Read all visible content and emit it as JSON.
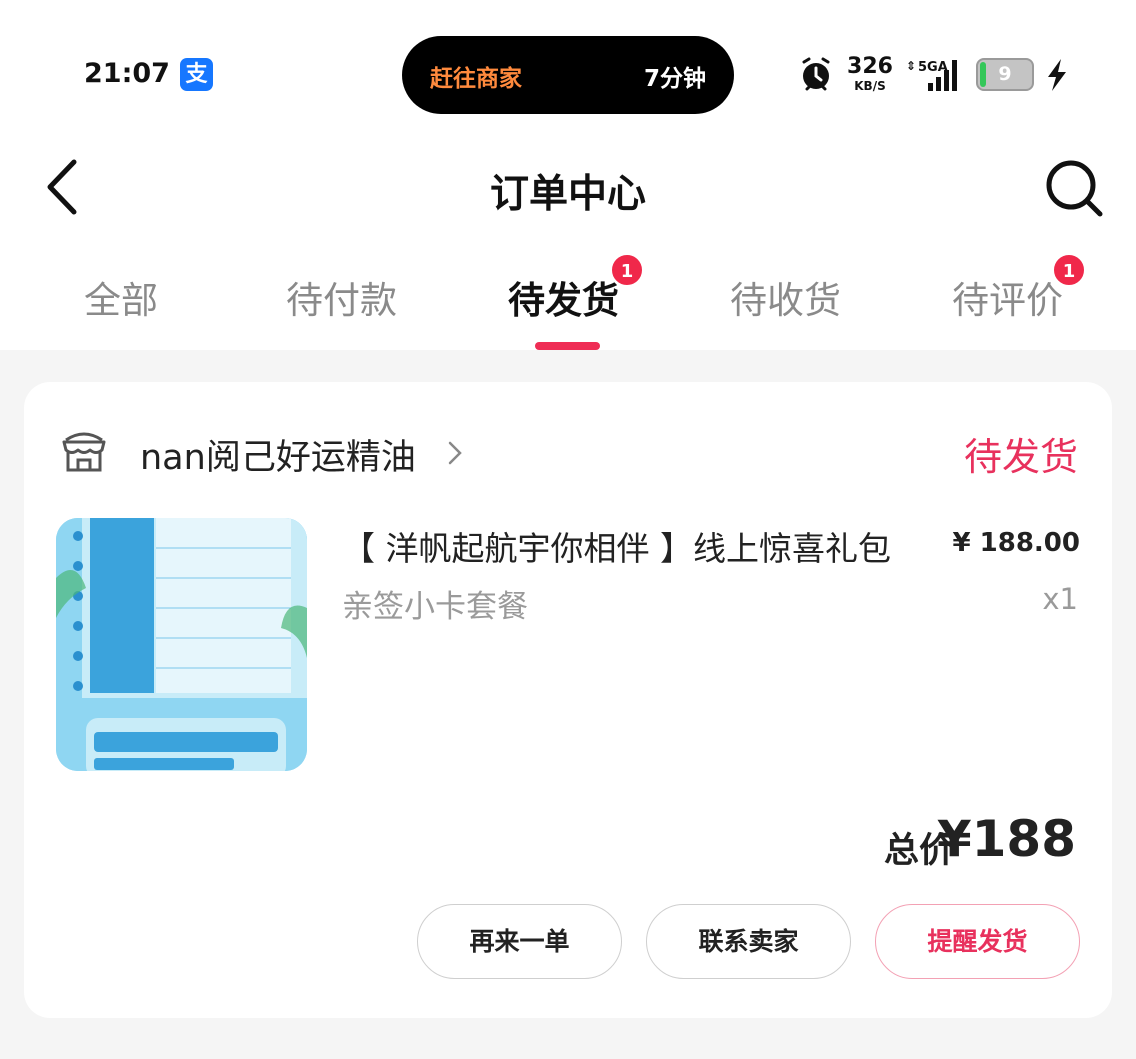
{
  "status_bar": {
    "time": "21:07",
    "app_icon": "支",
    "live_activity": {
      "left": "赶往商家",
      "right": "7分钟"
    },
    "net_speed": "326",
    "net_speed_unit": "KB/S",
    "network": "5GA",
    "battery": "9"
  },
  "nav": {
    "title": "订单中心"
  },
  "tabs": [
    {
      "label": "全部",
      "badge": ""
    },
    {
      "label": "待付款",
      "badge": ""
    },
    {
      "label": "待发货",
      "badge": "1",
      "active": true
    },
    {
      "label": "待收货",
      "badge": ""
    },
    {
      "label": "待评价",
      "badge": "1"
    }
  ],
  "order": {
    "shop_name": "nan阅己好运精油",
    "status": "待发货",
    "product_title": "【 洋帆起航宇你相伴 】线上惊喜礼包",
    "price": "¥ 188.00",
    "spec": "亲签小卡套餐",
    "quantity": "x1",
    "total_label": "总价",
    "total_value": "¥188",
    "buttons": [
      "再来一单",
      "联系卖家",
      "提醒发货"
    ]
  },
  "colors": {
    "accent": "#e8315d",
    "badge": "#f0284a",
    "background": "#f5f5f5"
  }
}
